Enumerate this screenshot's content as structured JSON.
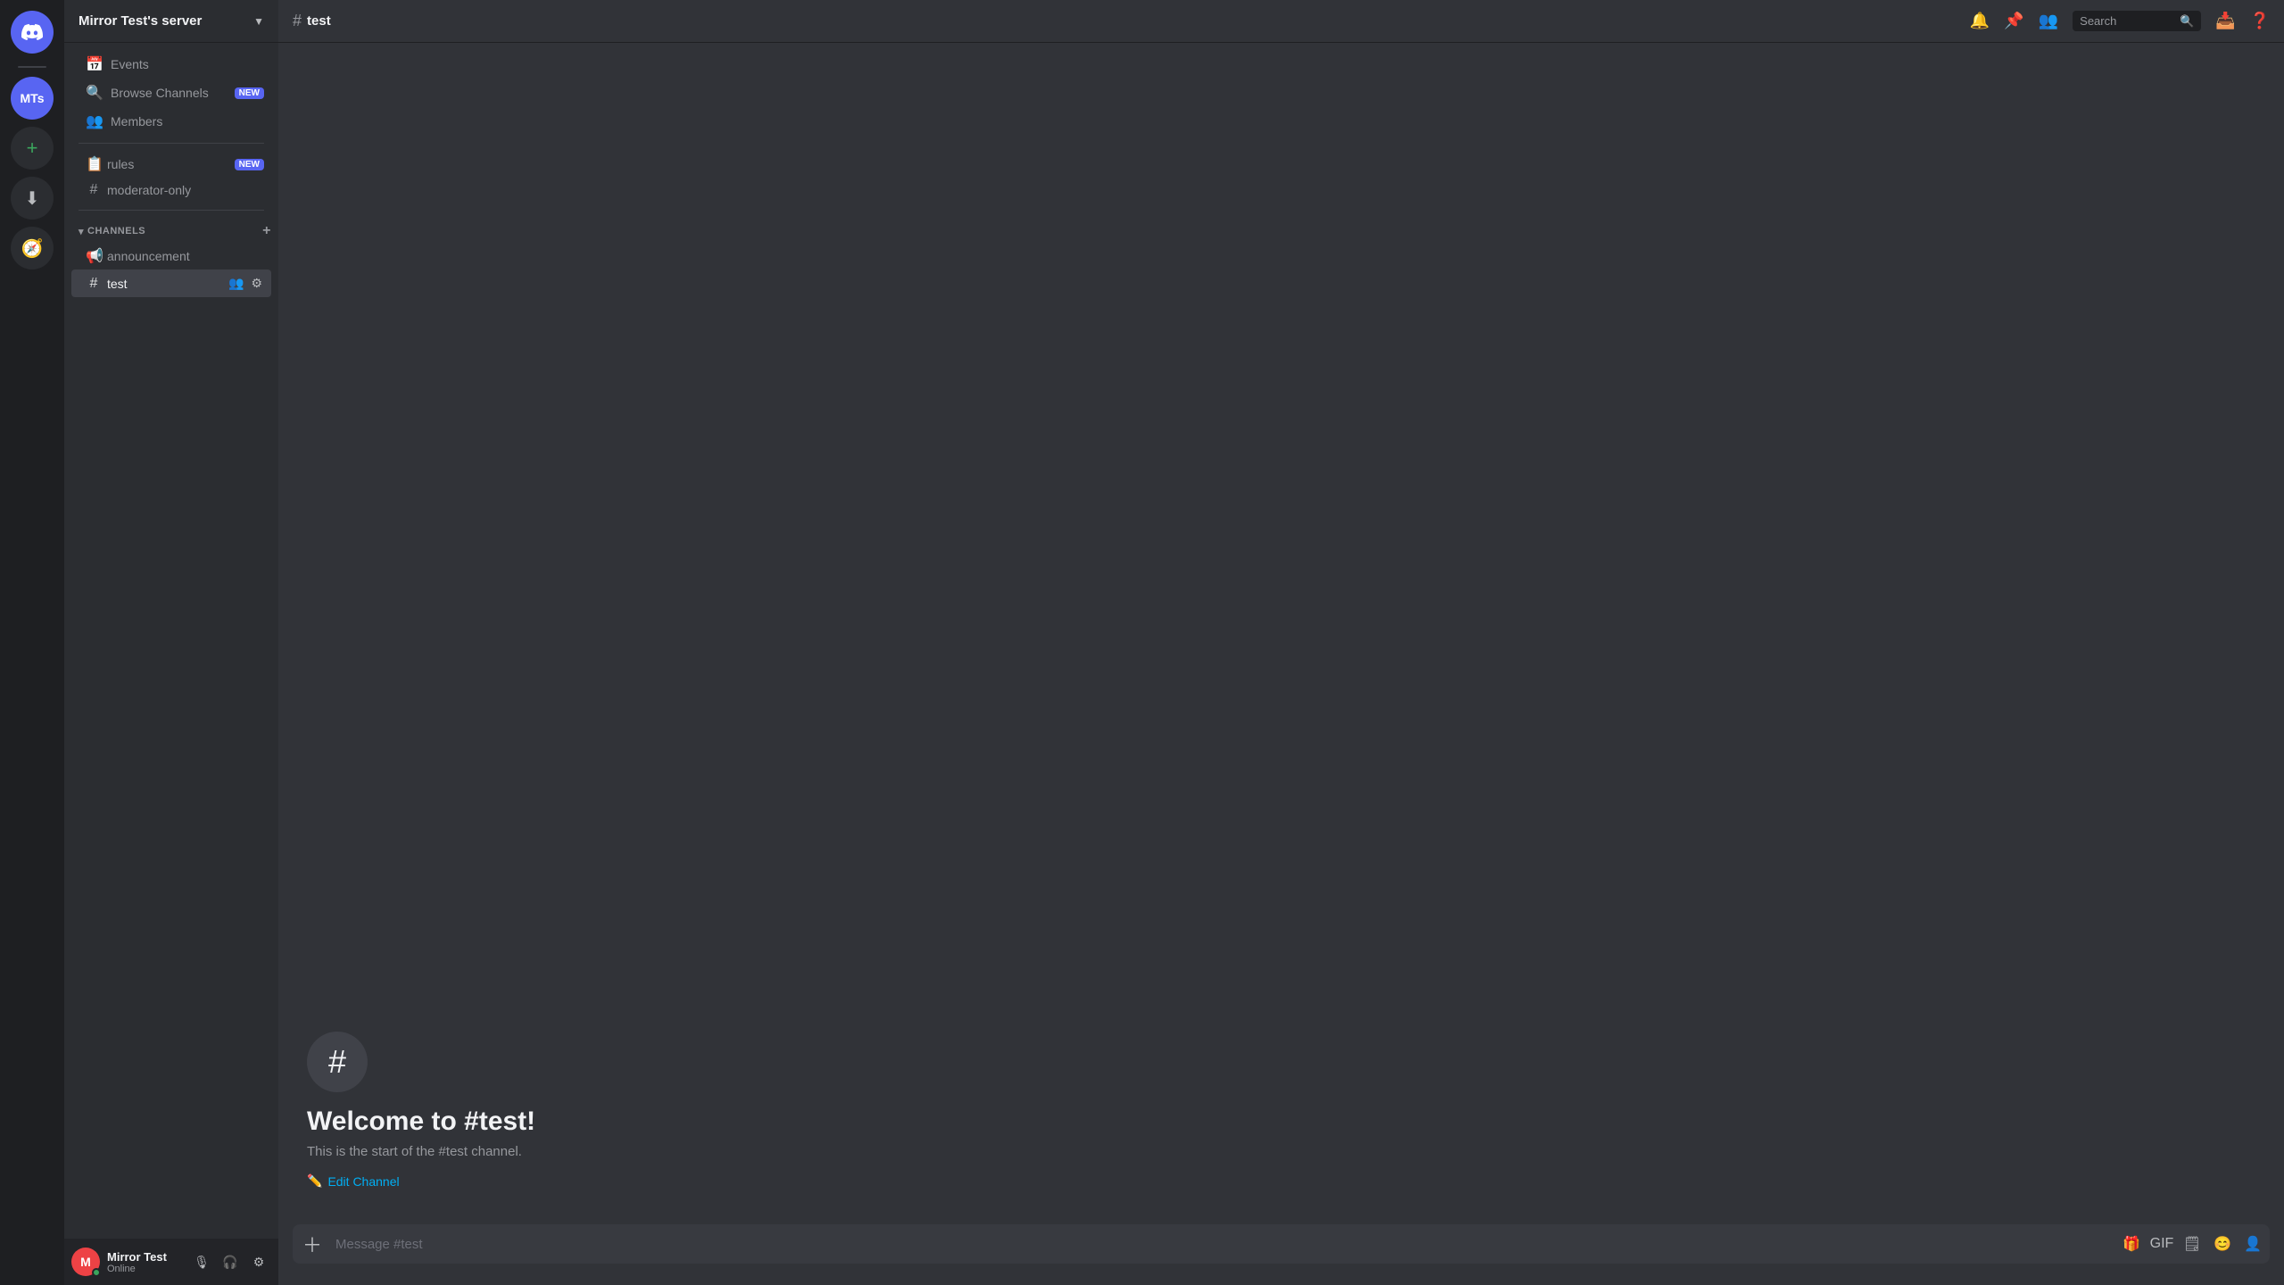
{
  "rail": {
    "discord_label": "Discord",
    "server_initials": "MTs",
    "add_label": "+",
    "download_label": "⬇"
  },
  "sidebar": {
    "server_name": "Mirror Test's server",
    "nav": {
      "events_label": "Events",
      "browse_channels_label": "Browse Channels",
      "browse_channels_badge": "NEW",
      "members_label": "Members",
      "rules_label": "rules",
      "rules_badge": "NEW",
      "moderator_only_label": "moderator-only"
    },
    "channels_section": "CHANNELS",
    "channels": [
      {
        "name": "announcement",
        "type": "announcement",
        "active": false
      },
      {
        "name": "test",
        "type": "text",
        "active": true
      }
    ]
  },
  "user": {
    "name": "Mirror Test",
    "status": "Online",
    "avatar_initials": "M"
  },
  "topbar": {
    "channel_name": "test",
    "search_placeholder": "Search"
  },
  "main": {
    "welcome_title": "Welcome to #test!",
    "welcome_desc": "This is the start of the #test channel.",
    "edit_channel_label": "Edit Channel",
    "message_placeholder": "Message #test"
  }
}
